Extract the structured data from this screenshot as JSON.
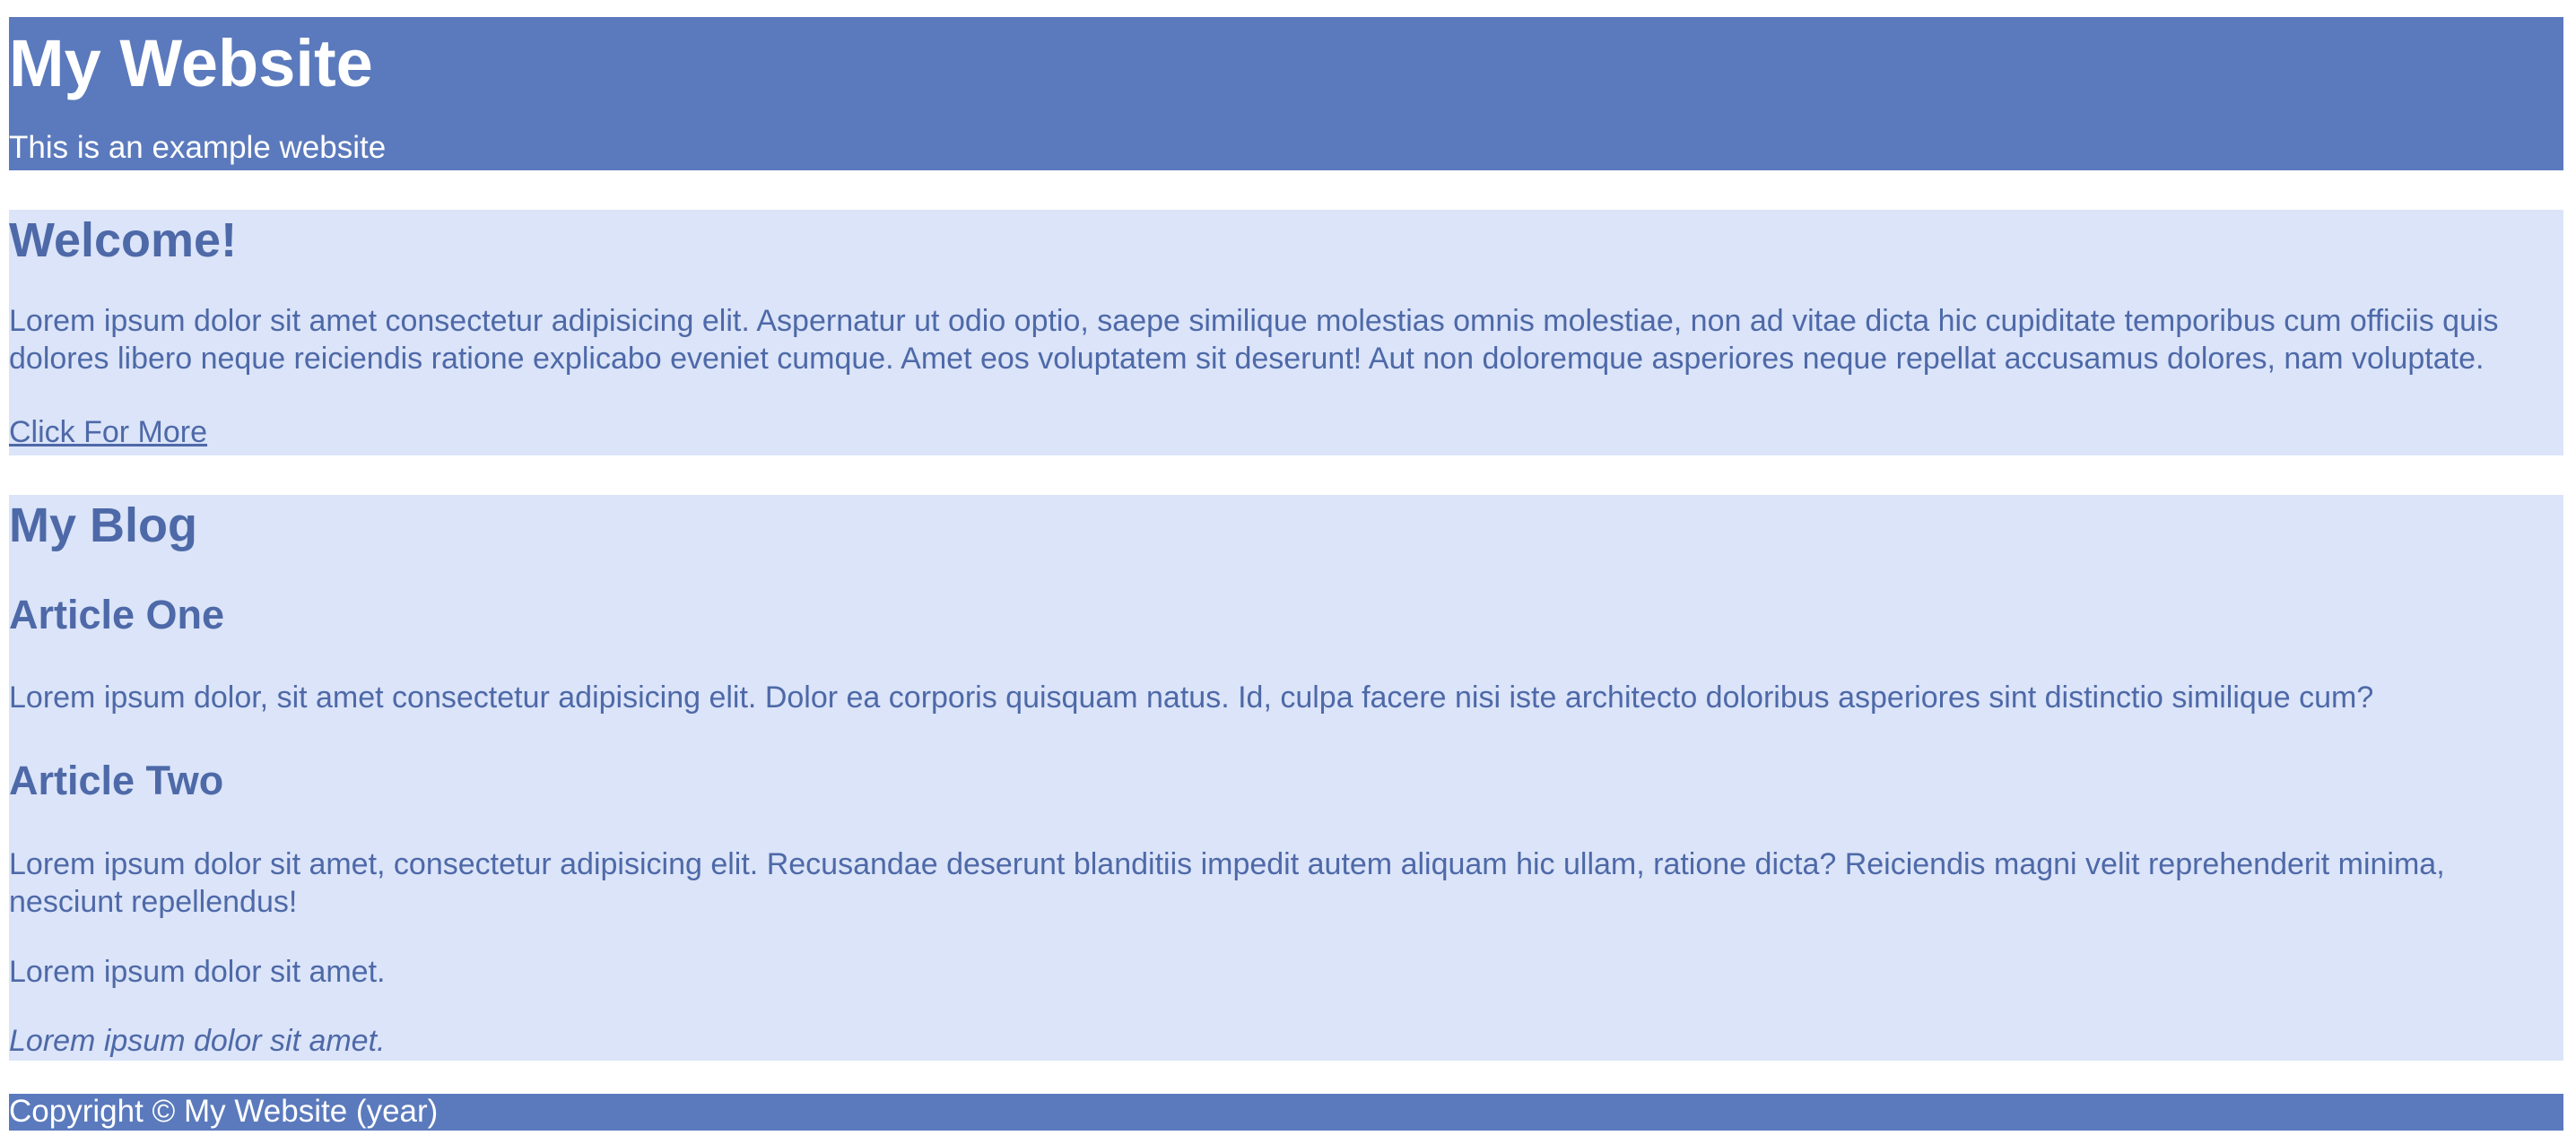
{
  "header": {
    "title": "My Website",
    "subtitle": "This is an example website"
  },
  "welcome": {
    "heading": "Welcome!",
    "body": "Lorem ipsum dolor sit amet consectetur adipisicing elit. Aspernatur ut odio optio, saepe similique molestias omnis molestiae, non ad vitae dicta hic cupiditate temporibus cum officiis quis dolores libero neque reiciendis ratione explicabo eveniet cumque. Amet eos voluptatem sit deserunt! Aut non doloremque asperiores neque repellat accusamus dolores, nam voluptate.",
    "link_label": "Click For More"
  },
  "blog": {
    "heading": "My Blog",
    "articles": [
      {
        "title": "Article One",
        "body": "Lorem ipsum dolor, sit amet consectetur adipisicing elit. Dolor ea corporis quisquam natus. Id, culpa facere nisi iste architecto doloribus asperiores sint distinctio similique cum?"
      },
      {
        "title": "Article Two",
        "body": "Lorem ipsum dolor sit amet, consectetur adipisicing elit. Recusandae deserunt blanditiis impedit autem aliquam hic ullam, ratione dicta? Reiciendis magni velit reprehenderit minima, nesciunt repellendus!",
        "extra": "Lorem ipsum dolor sit amet.",
        "extra_italic": "Lorem ipsum dolor sit amet."
      }
    ]
  },
  "footer": {
    "copyright": "Copyright © My Website (year)"
  },
  "colors": {
    "header_bg": "#5b7abd",
    "section_bg": "#dbe4f8",
    "section_text": "#4e69a8",
    "header_text": "#ffffff"
  }
}
